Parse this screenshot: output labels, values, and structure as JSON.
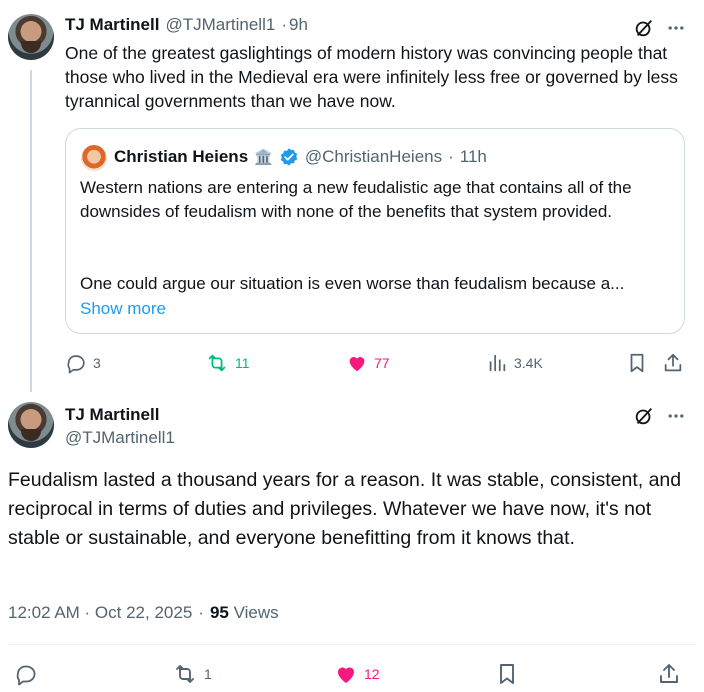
{
  "parent_tweet": {
    "author_name": "TJ Martinell",
    "handle": "@TJMartinell1",
    "time": "9h",
    "text": "One of the greatest gaslightings of modern history was convincing people that those who lived in the Medieval era were infinitely less free or governed by less tyrannical governments than we have now.",
    "quote": {
      "author_name": "Christian Heiens",
      "emoji": "🏛️",
      "handle": "@ChristianHeiens",
      "time": "11h",
      "text_p1": "Western nations are entering a new feudalistic age that contains all of the downsides of feudalism with none of the benefits that system provided.",
      "text_p2": "One could argue our situation is even worse than feudalism because a...",
      "show_more": "Show more"
    },
    "stats": {
      "replies": "3",
      "reposts": "11",
      "likes": "77",
      "views": "3.4K"
    }
  },
  "main_tweet": {
    "author_name": "TJ Martinell",
    "handle": "@TJMartinell1",
    "text": "Feudalism lasted a thousand years for a reason. It was stable, consistent, and reciprocal in terms of duties and privileges. Whatever we have now, it's not stable or sustainable, and everyone benefitting from it knows that.",
    "timestamp": "12:02 AM · Oct 22, 2025",
    "separator": "·",
    "views_count": "95",
    "views_label": "Views",
    "stats": {
      "reposts": "1",
      "likes": "12"
    }
  },
  "colors": {
    "accent": "#1d9bf0",
    "repost": "#00ba7c",
    "like": "#f91880",
    "muted": "#536471"
  }
}
